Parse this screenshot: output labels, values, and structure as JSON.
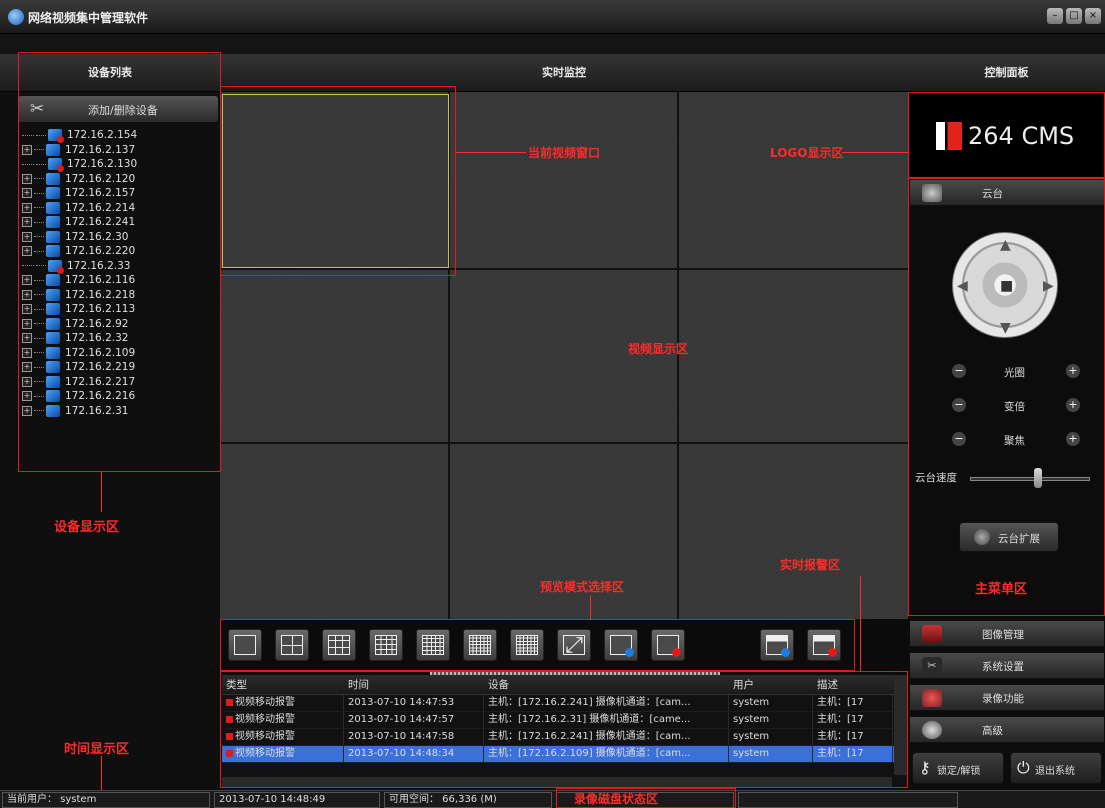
{
  "window": {
    "title": "网络视频集中管理软件",
    "controls": [
      "–",
      "□",
      "×"
    ]
  },
  "headers": {
    "device_list": "设备列表",
    "realtime": "实时监控",
    "control": "控制面板"
  },
  "device_panel": {
    "add_button": "添加/删除设备",
    "devices": [
      {
        "ip": "172.16.2.154",
        "expand": false,
        "offline": true
      },
      {
        "ip": "172.16.2.137",
        "expand": true,
        "offline": false
      },
      {
        "ip": "172.16.2.130",
        "expand": false,
        "offline": true
      },
      {
        "ip": "172.16.2.120",
        "expand": true,
        "offline": false
      },
      {
        "ip": "172.16.2.157",
        "expand": true,
        "offline": false
      },
      {
        "ip": "172.16.2.214",
        "expand": true,
        "offline": false
      },
      {
        "ip": "172.16.2.241",
        "expand": true,
        "offline": false
      },
      {
        "ip": "172.16.2.30",
        "expand": true,
        "offline": false
      },
      {
        "ip": "172.16.2.220",
        "expand": true,
        "offline": false
      },
      {
        "ip": "172.16.2.33",
        "expand": false,
        "offline": true
      },
      {
        "ip": "172.16.2.116",
        "expand": true,
        "offline": false
      },
      {
        "ip": "172.16.2.218",
        "expand": true,
        "offline": false
      },
      {
        "ip": "172.16.2.113",
        "expand": true,
        "offline": false
      },
      {
        "ip": "172.16.2.92",
        "expand": true,
        "offline": false
      },
      {
        "ip": "172.16.2.32",
        "expand": true,
        "offline": false
      },
      {
        "ip": "172.16.2.109",
        "expand": true,
        "offline": false
      },
      {
        "ip": "172.16.2.219",
        "expand": true,
        "offline": false
      },
      {
        "ip": "172.16.2.217",
        "expand": true,
        "offline": false
      },
      {
        "ip": "172.16.2.216",
        "expand": true,
        "offline": false
      },
      {
        "ip": "172.16.2.31",
        "expand": true,
        "offline": false
      }
    ]
  },
  "toolbar": {
    "buttons": [
      "layout-1-icon",
      "layout-4-icon",
      "layout-9-icon",
      "layout-16-icon",
      "layout-25-icon",
      "layout-36-icon",
      "layout-64-icon",
      "fullscreen-icon",
      "start-preview-icon",
      "stop-preview-icon",
      "start-record-icon",
      "stop-record-icon"
    ]
  },
  "alarm_table": {
    "columns": [
      "类型",
      "时间",
      "设备",
      "用户",
      "描述"
    ],
    "rows": [
      {
        "type": "视频移动报警",
        "time": "2013-07-10 14:47:53",
        "device": "主机：[172.16.2.241] 摄像机通道：[cam...",
        "user": "system",
        "desc": "主机：[17",
        "selected": false
      },
      {
        "type": "视频移动报警",
        "time": "2013-07-10 14:47:57",
        "device": "主机：[172.16.2.31] 摄像机通道：[came...",
        "user": "system",
        "desc": "主机：[17",
        "selected": false
      },
      {
        "type": "视频移动报警",
        "time": "2013-07-10 14:47:58",
        "device": "主机：[172.16.2.241] 摄像机通道：[cam...",
        "user": "system",
        "desc": "主机：[17",
        "selected": false
      },
      {
        "type": "视频移动报警",
        "time": "2013-07-10 14:48:34",
        "device": "主机：[172.16.2.109] 摄像机通道：[cam...",
        "user": "system",
        "desc": "主机：[17",
        "selected": true
      }
    ]
  },
  "control_panel": {
    "logo_text": "264 CMS",
    "ptz_tab": "云台",
    "iris": "光圈",
    "zoom": "变倍",
    "focus": "聚焦",
    "speed_label": "云台速度",
    "ptz_expand": "云台扩展",
    "menus": [
      "图像管理",
      "系统设置",
      "录像功能",
      "高级"
    ],
    "lock_button": "锁定/解锁",
    "exit_button": "退出系统"
  },
  "status": {
    "user": "当前用户： system",
    "datetime": "2013-07-10 14:48:49",
    "space": "可用空间： 66,336 (M)"
  },
  "annotations": {
    "current_window": "当前视频窗口",
    "logo_area": "LOGO显示区",
    "video_area": "视频显示区",
    "device_area": "设备显示区",
    "preview_mode": "预览模式选择区",
    "alarm_area": "实时报警区",
    "main_menu": "主菜单区",
    "time_area": "时间显示区",
    "disk_status": "录像磁盘状态区"
  },
  "colors": {
    "annotation": "#ff2a2a",
    "active_cell": "#c7c24a",
    "selection": "#3b6fd9",
    "logo_accent": "#e2231a"
  }
}
